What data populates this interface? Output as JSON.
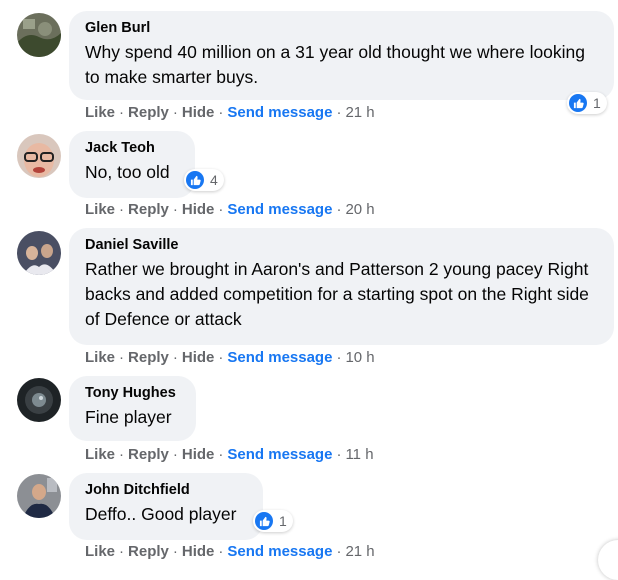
{
  "actions": {
    "like": "Like",
    "reply": "Reply",
    "hide": "Hide",
    "send_message": "Send message",
    "separator": "·"
  },
  "comments": [
    {
      "author": "Glen Burl",
      "text": "Why spend 40 million on a 31 year old thought we where looking to make smarter buys.",
      "time": "21 h",
      "reactions": "1"
    },
    {
      "author": "Jack Teoh",
      "text": "No, too old",
      "time": "20 h",
      "reactions": "4"
    },
    {
      "author": "Daniel Saville",
      "text": "Rather we brought in Aaron's and Patterson 2 young pacey Right backs and added competition for a starting spot on the Right side of Defence or attack",
      "time": "10 h",
      "reactions": ""
    },
    {
      "author": "Tony Hughes",
      "text": "Fine player",
      "time": "11 h",
      "reactions": ""
    },
    {
      "author": "John Ditchfield",
      "text": "Deffo.. Good player",
      "time": "21 h",
      "reactions": "1"
    }
  ],
  "colors": {
    "link": "#1877f2",
    "bubble": "#f0f2f5",
    "meta": "#65676b"
  },
  "icons": {
    "reaction": "like-icon"
  }
}
